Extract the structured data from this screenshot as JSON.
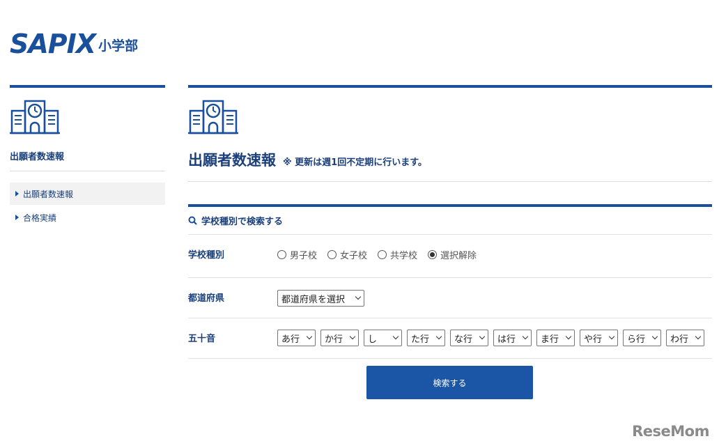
{
  "logo": {
    "main": "SAPIX",
    "sub": "小学部"
  },
  "sidebar": {
    "title": "出願者数速報",
    "items": [
      {
        "label": "出願者数速報"
      },
      {
        "label": "合格実績"
      }
    ]
  },
  "main": {
    "title": "出願者数速報",
    "note": "※ 更新は週1回不定期に行います。",
    "search_heading": "学校種別で検索する",
    "school_type": {
      "label": "学校種別",
      "options": [
        {
          "label": "男子校"
        },
        {
          "label": "女子校"
        },
        {
          "label": "共学校"
        },
        {
          "label": "選択解除"
        }
      ]
    },
    "prefecture": {
      "label": "都道府県",
      "value": "都道府県を選択"
    },
    "kana": {
      "label": "五十音",
      "options": [
        "あ行",
        "か行",
        "し",
        "た行",
        "な行",
        "は行",
        "ま行",
        "や行",
        "ら行",
        "わ行"
      ]
    },
    "submit_label": "検索する"
  },
  "watermark": "ReseMom",
  "colors": {
    "brand": "#1a4f9c",
    "button": "#1a55a6"
  }
}
